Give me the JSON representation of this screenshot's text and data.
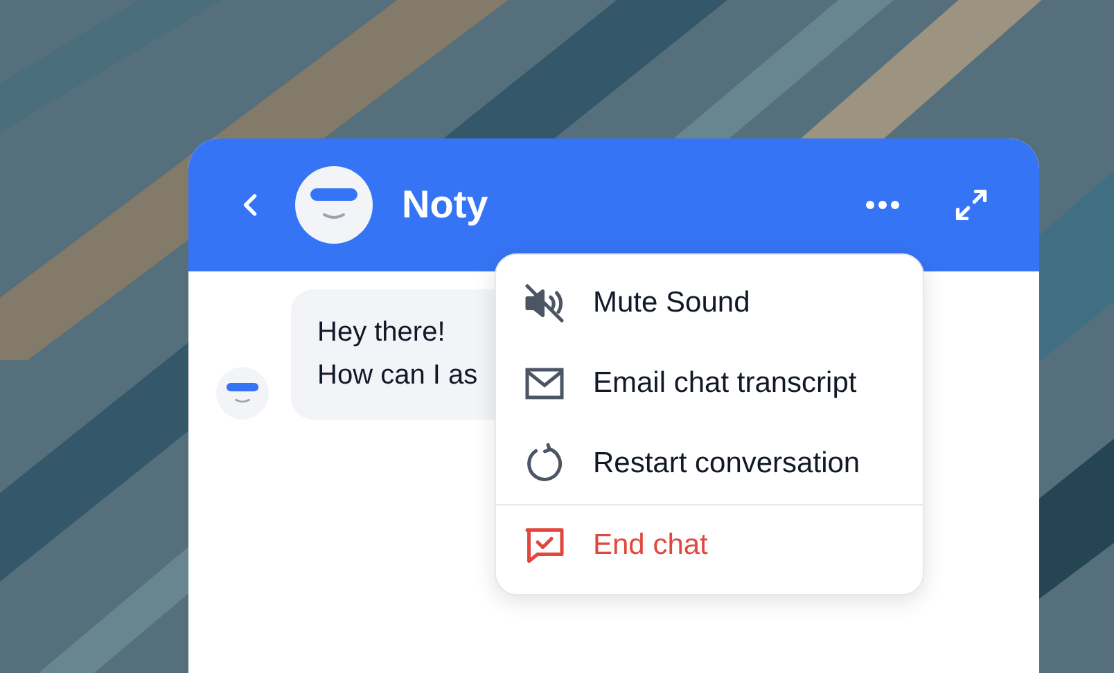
{
  "header": {
    "title": "Noty"
  },
  "messages": [
    {
      "lines": [
        "Hey there!",
        "How can I as"
      ]
    }
  ],
  "menu": {
    "items": [
      {
        "kind": "mute",
        "label": "Mute Sound"
      },
      {
        "kind": "email",
        "label": "Email chat transcript"
      },
      {
        "kind": "restart",
        "label": "Restart conversation"
      },
      {
        "kind": "end",
        "label": "End chat"
      }
    ]
  }
}
